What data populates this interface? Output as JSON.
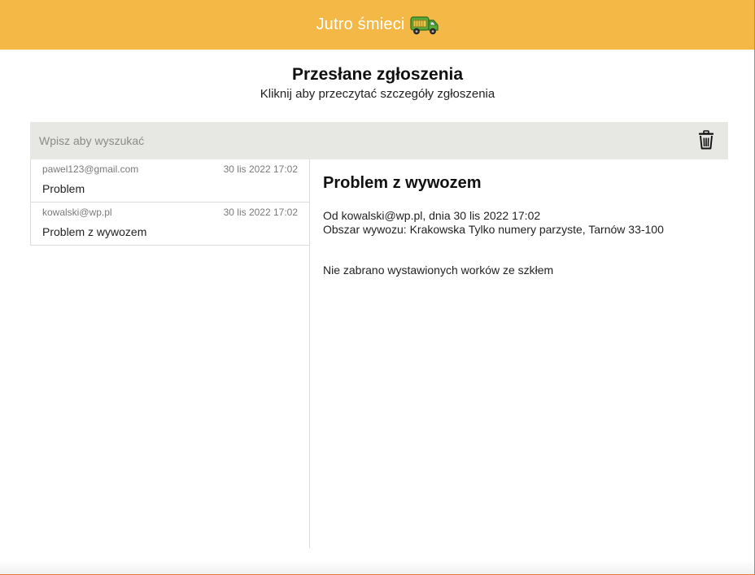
{
  "header": {
    "app_title": "Jutro śmieci",
    "logo_icon": "garbage-truck-icon",
    "background": "#f4b847"
  },
  "page": {
    "title": "Przesłane zgłoszenia",
    "subtitle": "Kliknij aby przeczytać szczegóły zgłoszenia"
  },
  "search": {
    "placeholder": "Wpisz aby wyszukać",
    "value": "",
    "delete_icon": "trash-icon"
  },
  "reports": [
    {
      "email": "pawel123@gmail.com",
      "date": "30 lis 2022 17:02",
      "subject": "Problem"
    },
    {
      "email": "kowalski@wp.pl",
      "date": "30 lis 2022 17:02",
      "subject": "Problem z wywozem"
    }
  ],
  "detail": {
    "title": "Problem z wywozem",
    "from_line": "Od kowalski@wp.pl, dnia 30 lis 2022 17:02",
    "area_line": "Obszar wywozu: Krakowska Tylko numery parzyste, Tarnów 33-100",
    "body": "Nie zabrano wystawionych worków ze szkłem"
  }
}
